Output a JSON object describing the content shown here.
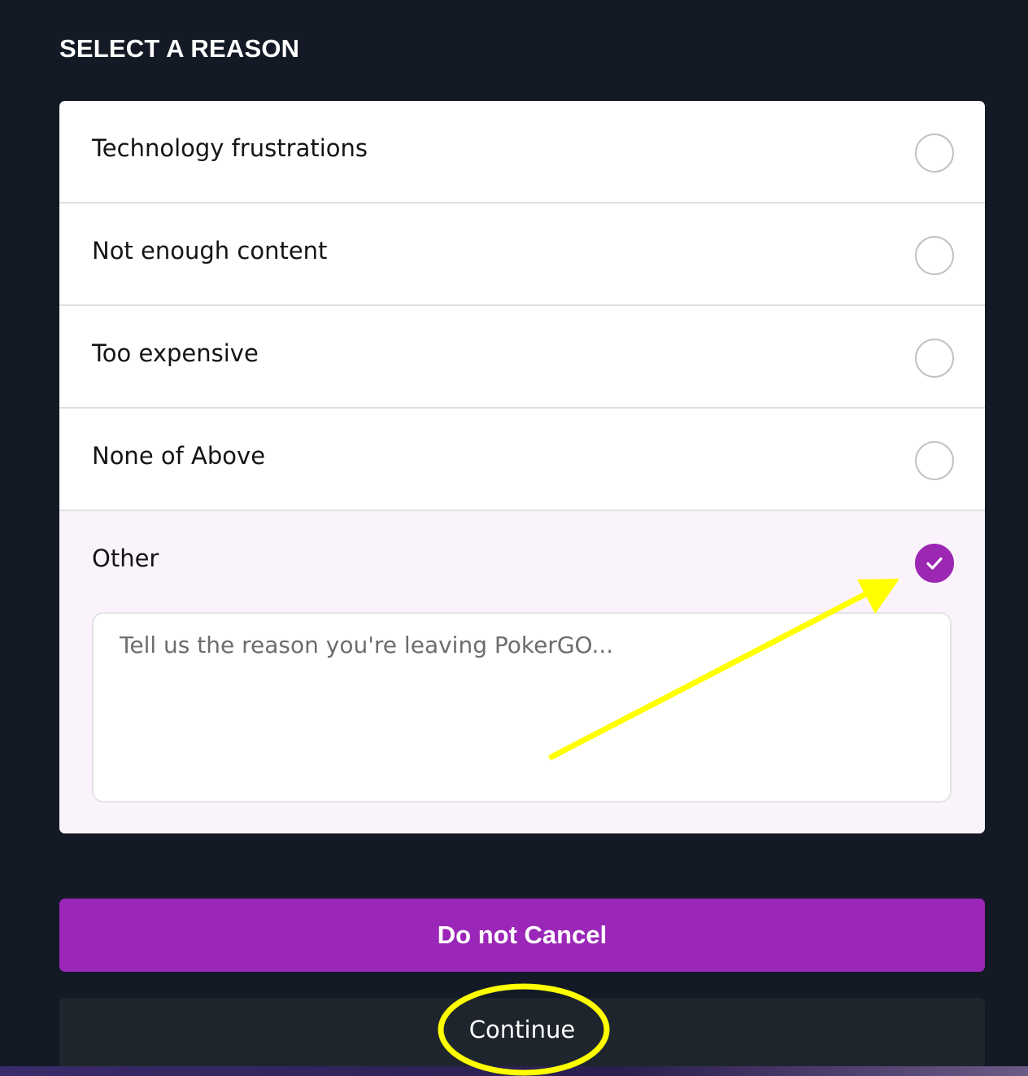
{
  "page": {
    "heading": "SELECT A REASON"
  },
  "reasons": [
    {
      "label": "Technology frustrations",
      "selected": false
    },
    {
      "label": "Not enough content",
      "selected": false
    },
    {
      "label": "Too expensive",
      "selected": false
    },
    {
      "label": "None of Above",
      "selected": false
    },
    {
      "label": "Other",
      "selected": true
    }
  ],
  "other_field": {
    "placeholder": "Tell us the reason you're leaving PokerGO...",
    "value": ""
  },
  "actions": {
    "primary_label": "Do not Cancel",
    "secondary_label": "Continue"
  },
  "colors": {
    "background": "#131a25",
    "accent": "#9b27b8",
    "annotation": "#ffff00"
  }
}
